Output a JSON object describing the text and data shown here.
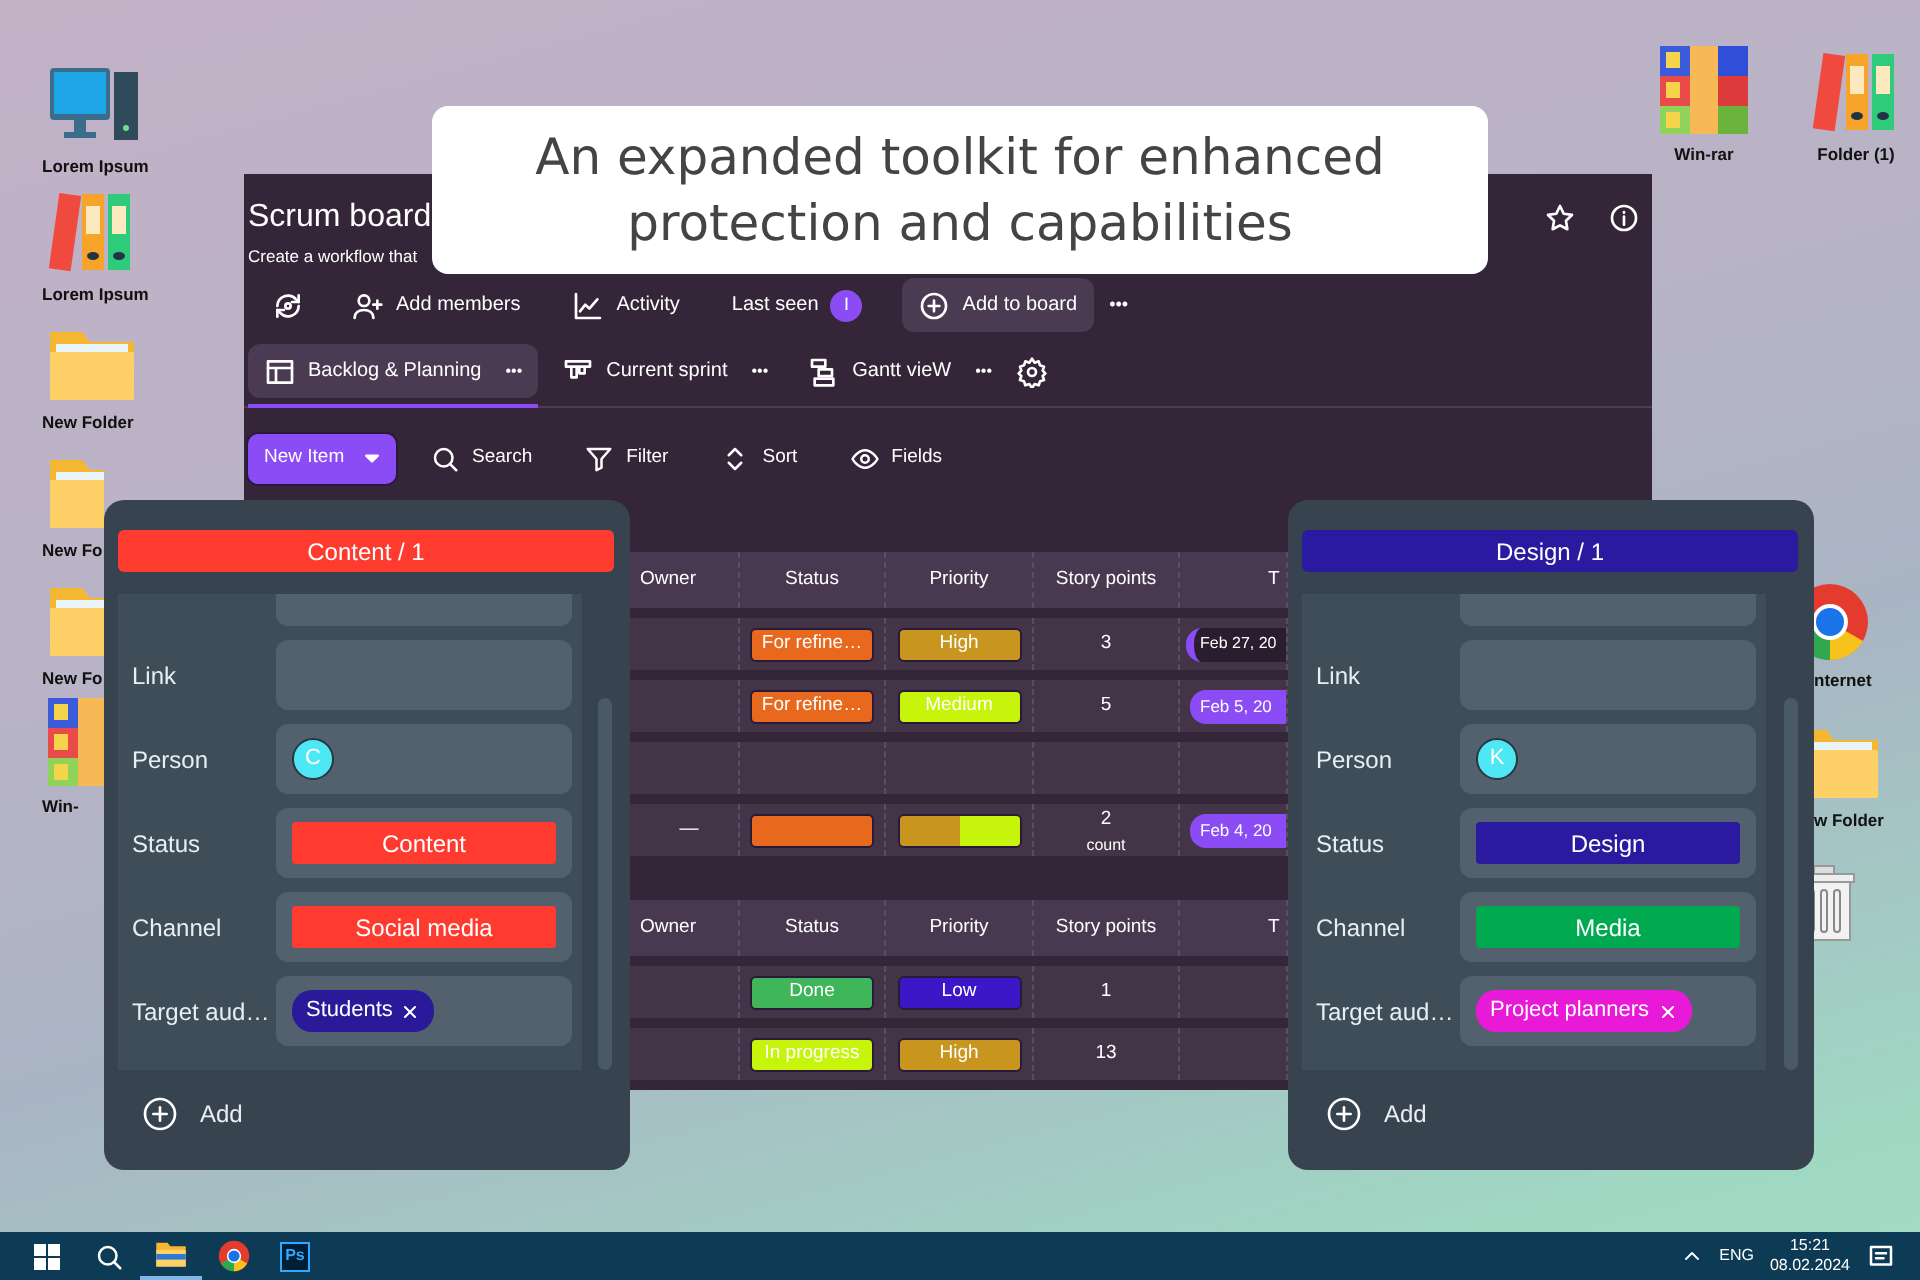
{
  "desktop": {
    "left_icons": [
      {
        "label": "Lorem Ipsum",
        "kind": "computer"
      },
      {
        "label": "Lorem Ipsum",
        "kind": "binders"
      },
      {
        "label": "New Folder",
        "kind": "folder"
      },
      {
        "label": "New Fo",
        "kind": "folder"
      },
      {
        "label": "New Fo",
        "kind": "folder"
      },
      {
        "label": "Win-",
        "kind": "archive"
      }
    ],
    "top_right_icons": [
      {
        "label": "Win-rar",
        "kind": "archive"
      },
      {
        "label": "Folder (1)",
        "kind": "binders"
      }
    ],
    "right_icons": [
      {
        "label": "nternet",
        "kind": "browser"
      },
      {
        "label": "w Folder",
        "kind": "folder"
      },
      {
        "kind": "trash"
      }
    ]
  },
  "banner": {
    "lines": [
      "An expanded toolkit for enhanced",
      "protection and capabilities"
    ]
  },
  "app": {
    "title": "Scrum board",
    "subtitle": "Create a workflow that",
    "toolbar": [
      {
        "kind": "sync"
      },
      {
        "kind": "add-person",
        "label": "Add members"
      },
      {
        "kind": "activity",
        "label": "Activity"
      },
      {
        "kind": "last-seen",
        "label": "Last seen",
        "avatar": "I"
      },
      {
        "kind": "add-board",
        "label": "Add to board"
      },
      {
        "kind": "more",
        "label": "•••"
      }
    ],
    "views": [
      {
        "kind": "table",
        "label": "Backlog & Planning",
        "more": "•••",
        "selected": true
      },
      {
        "kind": "board",
        "label": "Current sprint",
        "more": "•••",
        "selected": false
      },
      {
        "kind": "gantt",
        "label": "Gantt vieW",
        "more": "•••",
        "selected": false
      }
    ],
    "new_item": "New Item",
    "tools": [
      {
        "kind": "search",
        "label": "Search"
      },
      {
        "kind": "filter",
        "label": "Filter"
      },
      {
        "kind": "sort",
        "label": "Sort"
      },
      {
        "kind": "eye",
        "label": "Fields"
      }
    ],
    "groups": [
      {
        "columns": [
          "Owner",
          "Status",
          "Priority",
          "Story points",
          "T"
        ],
        "rows": [
          {
            "kind": "item",
            "status": {
              "text": "For refine…",
              "color": "#e8691e"
            },
            "priority": {
              "text": "High",
              "color": "#c8961f"
            },
            "points": "3",
            "date": {
              "kind": "range",
              "text": "Feb 27, 20"
            }
          },
          {
            "kind": "item",
            "status": {
              "text": "For refine…",
              "color": "#e8691e"
            },
            "priority": {
              "text": "Medium",
              "color": "#c6f40a"
            },
            "points": "5",
            "date": {
              "kind": "pill",
              "text": "Feb 5, 20"
            }
          },
          {
            "kind": "empty"
          },
          {
            "kind": "summary",
            "owner": "—",
            "status_segments": [
              {
                "color": "#e8691e",
                "level": 1
              }
            ],
            "priority_segments": [
              {
                "color": "#c8961f",
                "level": 0.5
              },
              {
                "color": "#c6f40a",
                "level": 0.5
              }
            ],
            "points": "2",
            "points_note": "count",
            "date": {
              "kind": "pill",
              "text": "Feb 4, 20"
            }
          }
        ]
      },
      {
        "columns": [
          "Owner",
          "Status",
          "Priority",
          "Story points",
          "T"
        ],
        "rows": [
          {
            "kind": "item",
            "status": {
              "text": "Done",
              "color": "#3fb65a"
            },
            "priority": {
              "text": "Low",
              "color": "#3a18c8"
            },
            "points": "1"
          },
          {
            "kind": "item",
            "status": {
              "text": "In progress",
              "color": "#c6f40a"
            },
            "priority": {
              "text": "High",
              "color": "#c8961f"
            },
            "points": "13"
          }
        ]
      }
    ]
  },
  "panels": [
    {
      "header": "Content / 1",
      "color": "#ff3b2f",
      "fields": [
        {
          "kind": "blank"
        },
        {
          "kind": "text",
          "label": "Link"
        },
        {
          "kind": "person",
          "label": "Person",
          "avatar": "C"
        },
        {
          "kind": "tag",
          "label": "Status",
          "value": "Content",
          "color": "#ff3b2f"
        },
        {
          "kind": "tag",
          "label": "Channel",
          "value": "Social media",
          "color": "#ff3b2f"
        },
        {
          "kind": "chips",
          "label": "Target aud…",
          "chips": [
            {
              "text": "Students",
              "color": "#2a1a9a"
            }
          ]
        }
      ],
      "add": "Add"
    },
    {
      "header": "Design / 1",
      "color": "#2a1aa0",
      "fields": [
        {
          "kind": "blank"
        },
        {
          "kind": "text",
          "label": "Link"
        },
        {
          "kind": "person",
          "label": "Person",
          "avatar": "K"
        },
        {
          "kind": "tag",
          "label": "Status",
          "value": "Design",
          "color": "#2a1aa0"
        },
        {
          "kind": "tag",
          "label": "Channel",
          "value": "Media",
          "color": "#00a84f"
        },
        {
          "kind": "chips",
          "label": "Target aud…",
          "chips": [
            {
              "text": "Project planners",
              "color": "#e81ad8"
            }
          ]
        }
      ],
      "add": "Add"
    }
  ],
  "taskbar": {
    "apps": [
      {
        "kind": "windows"
      },
      {
        "kind": "search"
      },
      {
        "kind": "explorer"
      },
      {
        "kind": "browser"
      },
      {
        "kind": "text",
        "label": "Ps"
      }
    ],
    "language": "ENG",
    "time": "15:21",
    "date": "08.02.2024"
  }
}
